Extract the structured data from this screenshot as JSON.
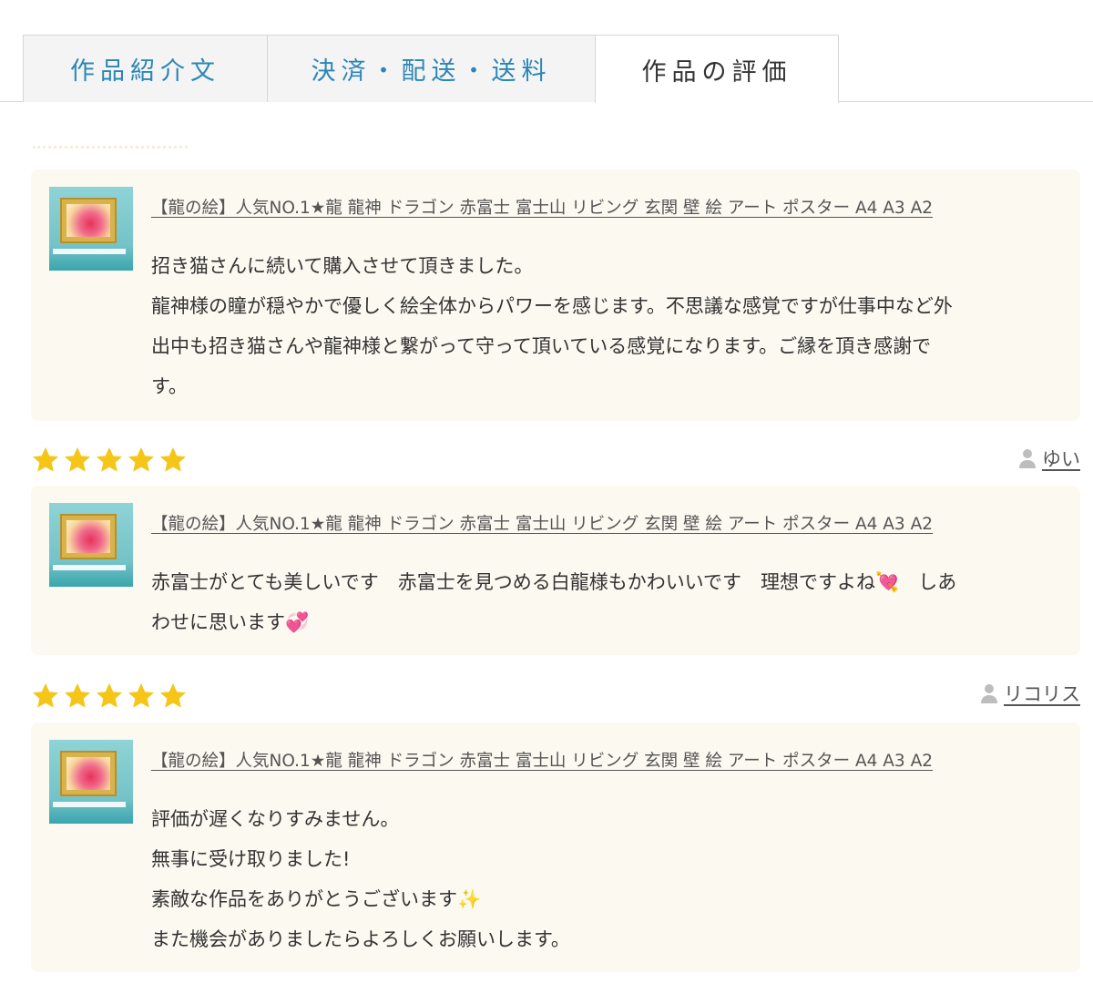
{
  "tabs": [
    {
      "label": "作品紹介文"
    },
    {
      "label": "決済・配送・送料"
    },
    {
      "label": "作品の評価"
    }
  ],
  "colors": {
    "accent": "#2a86b5",
    "star": "#f5c518",
    "card_bg": "#fbf9f0"
  },
  "reviews": [
    {
      "product_title": "【龍の絵】人気NO.1★龍 龍神 ドラゴン 赤富士 富士山 リビング 玄関 壁 絵 アート ポスター A4 A3 A2",
      "lines": [
        "招き猫さんに続いて購入させて頂きました。",
        "龍神様の瞳が穏やかで優しく絵全体からパワーを感じます。不思議な感覚ですが仕事中など外",
        "出中も招き猫さんや龍神様と繋がって守って頂いている感覚になります。ご縁を頂き感謝で",
        "す。"
      ]
    },
    {
      "rating": 5,
      "reviewer": "ゆい",
      "product_title": "【龍の絵】人気NO.1★龍 龍神 ドラゴン 赤富士 富士山 リビング 玄関 壁 絵 アート ポスター A4 A3 A2",
      "lines": [
        "赤富士がとても美しいです　赤富士を見つめる白龍様もかわいいです　理想ですよね💘　しあ",
        "わせに思います💞"
      ]
    },
    {
      "rating": 5,
      "reviewer": "リコリス",
      "product_title": "【龍の絵】人気NO.1★龍 龍神 ドラゴン 赤富士 富士山 リビング 玄関 壁 絵 アート ポスター A4 A3 A2",
      "lines": [
        "評価が遅くなりすみません。",
        "無事に受け取りました!",
        "素敵な作品をありがとうございます✨",
        "また機会がありましたらよろしくお願いします。"
      ]
    }
  ]
}
